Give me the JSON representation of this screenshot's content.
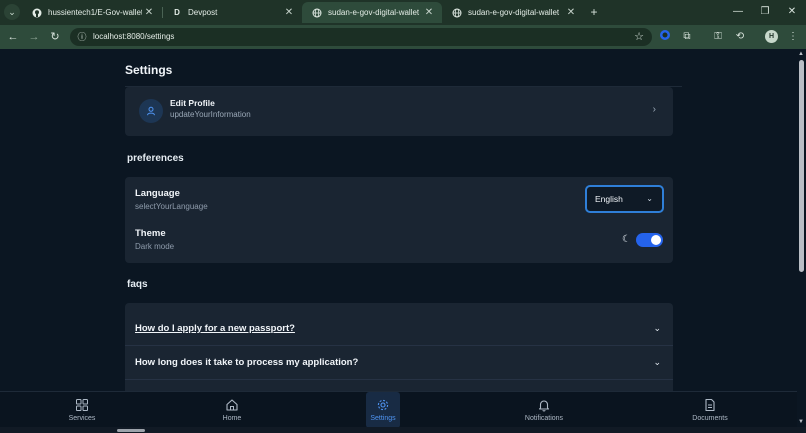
{
  "browser": {
    "tabs": [
      {
        "title": "hussientech1/E-Gov-wallet",
        "icon": "github-icon",
        "active": false
      },
      {
        "title": "Devpost",
        "icon": "devpost-icon",
        "favicon_letter": "D",
        "active": false
      },
      {
        "title": "sudan-e-gov-digital-wallet",
        "icon": "globe-icon",
        "active": true
      },
      {
        "title": "sudan-e-gov-digital-wallet",
        "icon": "globe-icon",
        "active": false
      }
    ],
    "url": "localhost:8080/settings",
    "profile_initial": "H"
  },
  "page": {
    "title": "Settings",
    "profile": {
      "title": "Edit Profile",
      "subtitle": "updateYourInformation"
    },
    "preferences": {
      "heading": "preferences",
      "language_label": "Language",
      "language_sub": "selectYourLanguage",
      "language_value": "English",
      "theme_label": "Theme",
      "theme_sub": "Dark mode",
      "dark_mode_on": true
    },
    "faqs": {
      "heading": "faqs",
      "items": [
        "How do I apply for a new passport?",
        "How long does it take to process my application?"
      ]
    }
  },
  "bottom_nav": [
    {
      "label": "Services",
      "icon": "grid-icon",
      "active": false
    },
    {
      "label": "Home",
      "icon": "home-icon",
      "active": false
    },
    {
      "label": "Settings",
      "icon": "gear-icon",
      "active": true
    },
    {
      "label": "Notifications",
      "icon": "bell-icon",
      "active": false
    },
    {
      "label": "Documents",
      "icon": "document-icon",
      "active": false
    }
  ],
  "colors": {
    "accent": "#2563eb",
    "background": "#0b1622",
    "card": "#1a2532",
    "browser_frame": "#1f3328"
  }
}
